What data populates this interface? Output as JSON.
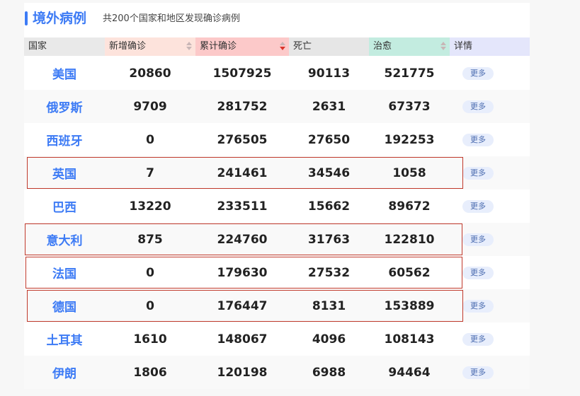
{
  "header": {
    "title": "境外病例",
    "subtitle": "共200个国家和地区发现确诊病例"
  },
  "columns": [
    "国家",
    "新增确诊",
    "累计确诊",
    "死亡",
    "治愈",
    "详情"
  ],
  "column_colors": [
    "#e9e9e9",
    "#fde3dc",
    "#fcc9c9",
    "#e6e6e6",
    "#c3ece0",
    "#e4e6fb"
  ],
  "sorted_column": "累计确诊",
  "more_label": "更多",
  "rows": [
    {
      "country": "美国",
      "new": "20860",
      "total": "1507925",
      "deaths": "90113",
      "cured": "521775"
    },
    {
      "country": "俄罗斯",
      "new": "9709",
      "total": "281752",
      "deaths": "2631",
      "cured": "67373"
    },
    {
      "country": "西班牙",
      "new": "0",
      "total": "276505",
      "deaths": "27650",
      "cured": "192253"
    },
    {
      "country": "英国",
      "new": "7",
      "total": "241461",
      "deaths": "34546",
      "cured": "1058"
    },
    {
      "country": "巴西",
      "new": "13220",
      "total": "233511",
      "deaths": "15662",
      "cured": "89672"
    },
    {
      "country": "意大利",
      "new": "875",
      "total": "224760",
      "deaths": "31763",
      "cured": "122810"
    },
    {
      "country": "法国",
      "new": "0",
      "total": "179630",
      "deaths": "27532",
      "cured": "60562"
    },
    {
      "country": "德国",
      "new": "0",
      "total": "176447",
      "deaths": "8131",
      "cured": "153889"
    },
    {
      "country": "土耳其",
      "new": "1610",
      "total": "148067",
      "deaths": "4096",
      "cured": "108143"
    },
    {
      "country": "伊朗",
      "new": "1806",
      "total": "120198",
      "deaths": "6988",
      "cured": "94464"
    }
  ],
  "highlighted_countries": [
    "英国",
    "意大利",
    "法国",
    "德国"
  ],
  "colors": {
    "accent": "#3d7bf5",
    "highlight_border": "#c0392b"
  }
}
